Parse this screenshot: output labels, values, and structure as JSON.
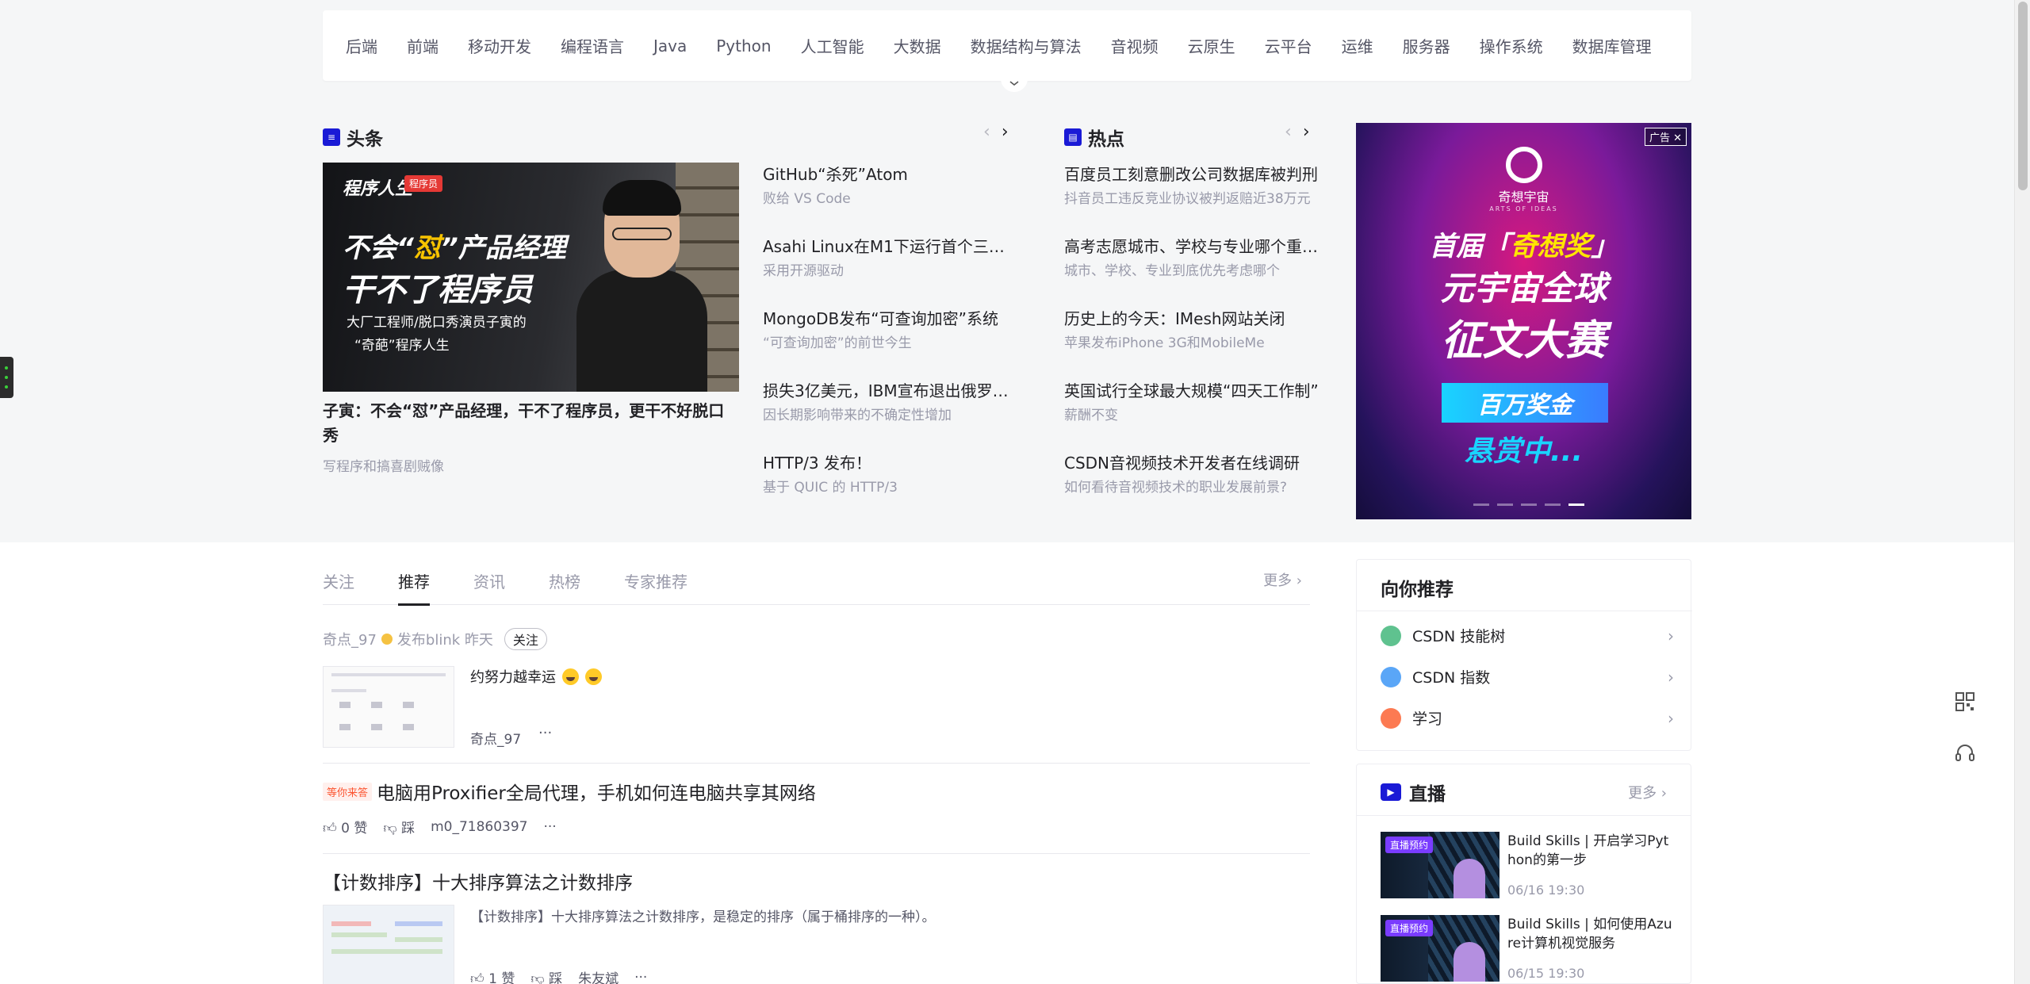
{
  "nav": {
    "items": [
      "后端",
      "前端",
      "移动开发",
      "编程语言",
      "Java",
      "Python",
      "人工智能",
      "大数据",
      "数据结构与算法",
      "音视频",
      "云原生",
      "云平台",
      "运维",
      "服务器",
      "操作系统",
      "数据库管理"
    ]
  },
  "headline": {
    "section_title": "头条",
    "image": {
      "badge1": "程序人生",
      "badge2": "程序员",
      "line1_a": "不会“",
      "line1_b": "怼",
      "line1_c": "”产品经理",
      "line2": "干不了程序员",
      "line3": "大厂工程师/脱口秀演员子寅的",
      "line4": "“奇葩”程序人生"
    },
    "title": "子寅：不会“怼”产品经理，干不了程序员，更干不好脱口秀",
    "subtitle": "写程序和搞喜剧贼像",
    "news": [
      {
        "title": "GitHub“杀死”Atom",
        "sub": "败给 VS Code"
      },
      {
        "title": "Asahi Linux在M1下运行首个三角形",
        "sub": "采用开源驱动"
      },
      {
        "title": "MongoDB发布“可查询加密”系统",
        "sub": "“可查询加密”的前世今生"
      },
      {
        "title": "损失3亿美元，IBM宣布退出俄罗斯市场",
        "sub": "因长期影响带来的不确定性增加"
      },
      {
        "title": "HTTP/3 发布！",
        "sub": "基于 QUIC 的 HTTP/3"
      }
    ]
  },
  "hot": {
    "section_title": "热点",
    "news": [
      {
        "title": "百度员工刻意删改公司数据库被判刑",
        "sub": "抖音员工违反竞业协议被判返赔近38万元"
      },
      {
        "title": "高考志愿城市、学校与专业哪个重要？",
        "sub": "城市、学校、专业到底优先考虑哪个"
      },
      {
        "title": "历史上的今天：IMesh网站关闭",
        "sub": "苹果发布iPhone 3G和MobileMe"
      },
      {
        "title": "英国试行全球最大规模“四天工作制”",
        "sub": "薪酬不变"
      },
      {
        "title": "CSDN音视频技术开发者在线调研",
        "sub": "如何看待音视频技术的职业发展前景?"
      }
    ]
  },
  "ad": {
    "tag": "广告",
    "brand": "奇想宇宙",
    "brand_en": "ARTS OF IDEAS",
    "line1_a": "首届「",
    "line1_b": "奇想奖",
    "line1_c": "」",
    "line2": "元宇宙全球",
    "line3": "征文大赛",
    "box": "百万奖金",
    "line4": "悬赏中..."
  },
  "feed": {
    "tabs": [
      "关注",
      "推荐",
      "资讯",
      "热榜",
      "专家推荐"
    ],
    "active_tab": 1,
    "more": "更多",
    "blink": {
      "user": "奇点_97",
      "action": "发布blink 昨天",
      "follow": "关注",
      "text": "约努力越幸运",
      "author": "奇点_97",
      "dots": "···"
    },
    "articles": [
      {
        "tag": "等你来答",
        "title": "电脑用Proxifier全局代理，手机如何连电脑共享其网络",
        "likes": "0 赞",
        "dislike": "踩",
        "author": "m0_71860397",
        "dots": "···"
      },
      {
        "title": "【计数排序】十大排序算法之计数排序",
        "desc": "【计数排序】十大排序算法之计数排序，是稳定的排序（属于桶排序的一种）。",
        "likes": "1 赞",
        "dislike": "踩",
        "author": "朱友斌",
        "dots": "···"
      }
    ]
  },
  "recommend": {
    "title": "向你推荐",
    "items": [
      {
        "label": "CSDN 技能树",
        "color": "#5fc28f"
      },
      {
        "label": "CSDN 指数",
        "color": "#5aa6f7"
      },
      {
        "label": "学习",
        "color": "#fc7a52"
      }
    ]
  },
  "live": {
    "title": "直播",
    "more": "更多",
    "items": [
      {
        "tag": "直播预约",
        "title": "Build Skills | 开启学习Python的第一步",
        "time": "06/16 19:30"
      },
      {
        "tag": "直播预约",
        "title": "Build Skills | 如何使用Azure计算机视觉服务",
        "time": "06/15 19:30"
      }
    ]
  }
}
